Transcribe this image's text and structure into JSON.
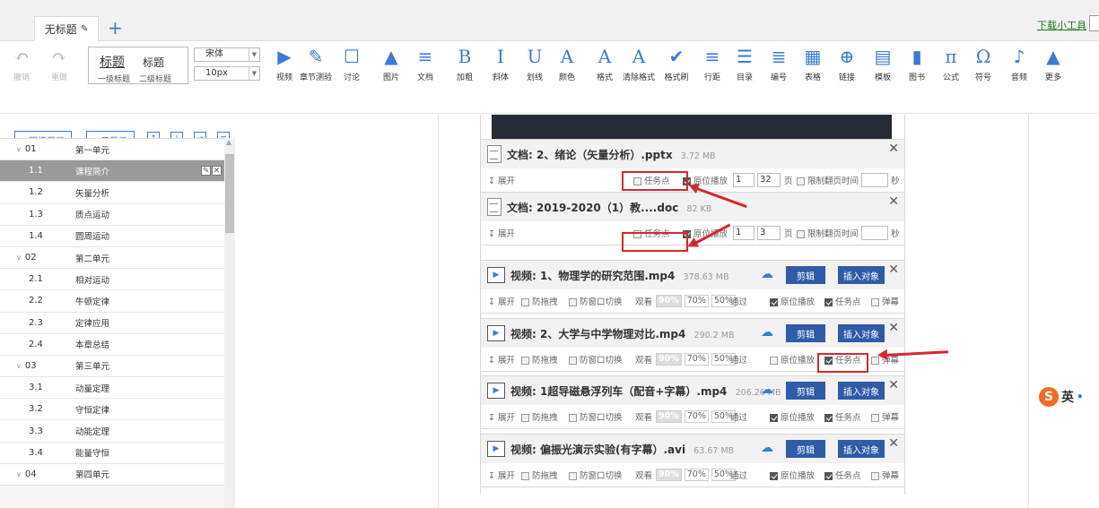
{
  "tabs": {
    "active_label": "无标题",
    "add": "+"
  },
  "header_right": {
    "download_tool": "下载小工具"
  },
  "toolbar": {
    "undo": "撤销",
    "redo": "重做",
    "heading_main": "标题",
    "heading_sub": "标题",
    "heading_level1": "一级标题",
    "heading_level2": "二级标题",
    "font_family": "宋体",
    "font_size": "10px",
    "items": [
      {
        "label": "视频",
        "icon": "video-icon",
        "glyph": "▶"
      },
      {
        "label": "章节测验",
        "icon": "quiz-icon",
        "glyph": "✎"
      },
      {
        "label": "讨论",
        "icon": "discuss-icon",
        "glyph": "☐"
      },
      {
        "label": "图片",
        "icon": "image-icon",
        "glyph": "▲"
      },
      {
        "label": "文档",
        "icon": "document-icon",
        "glyph": "≡"
      },
      {
        "label": "加粗",
        "icon": "bold-icon",
        "glyph": "B"
      },
      {
        "label": "斜体",
        "icon": "italic-icon",
        "glyph": "I"
      },
      {
        "label": "划线",
        "icon": "underline-icon",
        "glyph": "U"
      },
      {
        "label": "颜色",
        "icon": "color-icon",
        "glyph": "A"
      },
      {
        "label": "格式",
        "icon": "format-icon",
        "glyph": "A"
      },
      {
        "label": "清除格式",
        "icon": "clear-format-icon",
        "glyph": "A"
      },
      {
        "label": "格式刷",
        "icon": "format-brush-icon",
        "glyph": "✔"
      },
      {
        "label": "行距",
        "icon": "line-spacing-icon",
        "glyph": "≡"
      },
      {
        "label": "目录",
        "icon": "toc-icon",
        "glyph": "☰"
      },
      {
        "label": "编号",
        "icon": "numbering-icon",
        "glyph": "≣"
      },
      {
        "label": "表格",
        "icon": "table-icon",
        "glyph": "▦"
      },
      {
        "label": "链接",
        "icon": "link-icon",
        "glyph": "⊕"
      },
      {
        "label": "模板",
        "icon": "template-icon",
        "glyph": "▤"
      },
      {
        "label": "图书",
        "icon": "book-icon",
        "glyph": "▮"
      },
      {
        "label": "公式",
        "icon": "formula-icon",
        "glyph": "π"
      },
      {
        "label": "符号",
        "icon": "symbol-icon",
        "glyph": "Ω"
      },
      {
        "label": "音频",
        "icon": "audio-icon",
        "glyph": "♪"
      },
      {
        "label": "更多",
        "icon": "more-icon",
        "glyph": "▲"
      }
    ]
  },
  "outline": {
    "add_sibling": "+同级目录",
    "add_child": "+子目录",
    "rows": [
      {
        "num": "01",
        "name": "第一单元",
        "unit": true
      },
      {
        "num": "1.1",
        "name": "课程简介",
        "selected": true
      },
      {
        "num": "1.2",
        "name": "矢量分析"
      },
      {
        "num": "1.3",
        "name": "质点运动"
      },
      {
        "num": "1.4",
        "name": "圆周运动"
      },
      {
        "num": "02",
        "name": "第二单元",
        "unit": true
      },
      {
        "num": "2.1",
        "name": "相对运动"
      },
      {
        "num": "2.2",
        "name": "牛顿定律"
      },
      {
        "num": "2.3",
        "name": "定律应用"
      },
      {
        "num": "2.4",
        "name": "本章总结"
      },
      {
        "num": "03",
        "name": "第三单元",
        "unit": true
      },
      {
        "num": "3.1",
        "name": "动量定理"
      },
      {
        "num": "3.2",
        "name": "守恒定律"
      },
      {
        "num": "3.3",
        "name": "动能定理"
      },
      {
        "num": "3.4",
        "name": "能量守恒"
      },
      {
        "num": "04",
        "name": "第四单元",
        "unit": true
      }
    ]
  },
  "labels": {
    "expand": "展开",
    "task_point": "任务点",
    "original_play": "原位播放",
    "page_unit": "页",
    "limit_time": "限制翻页时间",
    "second_unit": "秒",
    "anti_drag": "防拖拽",
    "anti_switch": "防窗口切换",
    "watch": "观看",
    "pass": "通过",
    "popup": "弹幕",
    "clip": "剪辑",
    "insert": "插入对象",
    "pct_options": [
      "90%",
      "70%",
      "50%"
    ]
  },
  "documents": [
    {
      "prefix": "文档:",
      "title": "2、绪论（矢量分析）.pptx",
      "size": "3.72 MB",
      "page_from": "1",
      "page_to": "32",
      "task_point": false,
      "original_play": true
    },
    {
      "prefix": "文档:",
      "title": "2019-2020（1）教....doc",
      "size": "82 KB",
      "page_from": "1",
      "page_to": "3",
      "task_point": false,
      "original_play": true
    }
  ],
  "videos": [
    {
      "prefix": "视频:",
      "title": "1、物理学的研究范围.mp4",
      "size": "378.63 MB",
      "original_play": true,
      "task_point": true,
      "popup": false
    },
    {
      "prefix": "视频:",
      "title": "2、大学与中学物理对比.mp4",
      "size": "290.2 MB",
      "original_play": false,
      "task_point": true,
      "popup": false
    },
    {
      "prefix": "视频:",
      "title": "1超导磁悬浮列车（配音+字幕）.mp4",
      "size": "206.26 MB",
      "original_play": true,
      "task_point": true,
      "popup": false
    },
    {
      "prefix": "视频:",
      "title": "偏振光演示实验(有字幕）.avi",
      "size": "63.67 MB",
      "original_play": true,
      "task_point": true,
      "popup": false
    }
  ],
  "ime": {
    "label": "英"
  },
  "colors": {
    "accent": "#3a7bd5",
    "button": "#2f5ba8",
    "annotation": "#d9262c",
    "selected_row": "#9a9a9a"
  }
}
